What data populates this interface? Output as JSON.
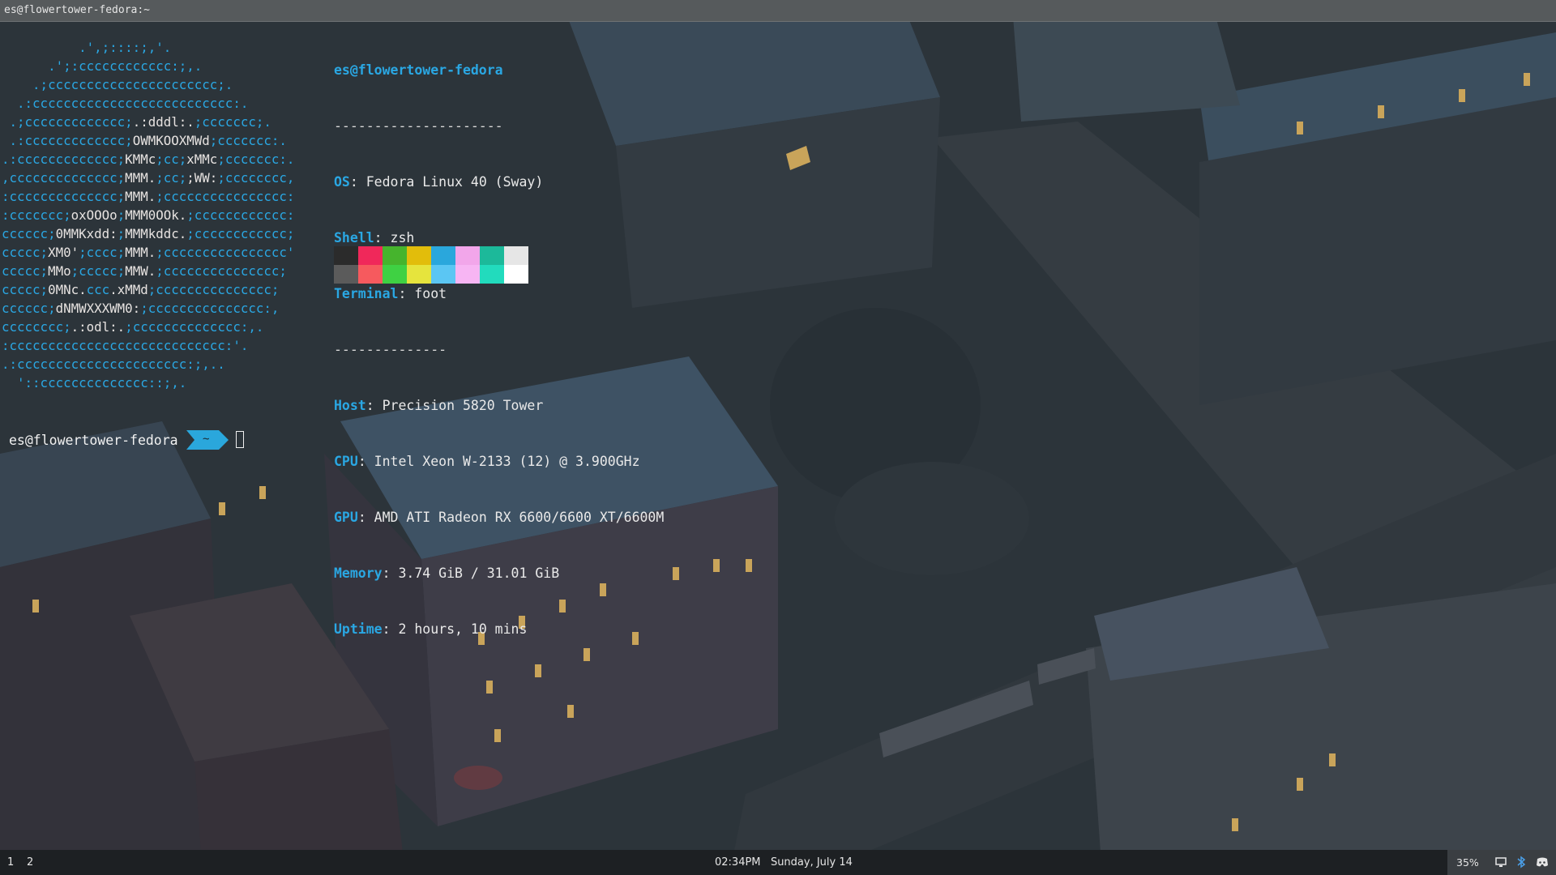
{
  "window": {
    "title": "es@flowertower-fedora:~"
  },
  "logo_lines": [
    [
      [
        "b",
        "          .',;::::;,'."
      ]
    ],
    [
      [
        "b",
        "      .';:cccccccccccc:;,."
      ]
    ],
    [
      [
        "b",
        "    .;cccccccccccccccccccccc;."
      ]
    ],
    [
      [
        "b",
        "  .:cccccccccccccccccccccccccc:."
      ]
    ],
    [
      [
        "b",
        " .;ccccccccccccc;"
      ],
      [
        "w",
        ".:dddl:."
      ],
      [
        "b",
        ";ccccccc;."
      ]
    ],
    [
      [
        "b",
        " .:ccccccccccccc;"
      ],
      [
        "w",
        "OWMKOOXMWd"
      ],
      [
        "b",
        ";ccccccc:."
      ]
    ],
    [
      [
        "b",
        ".:ccccccccccccc;"
      ],
      [
        "w",
        "KMMc"
      ],
      [
        "b",
        ";cc;"
      ],
      [
        "w",
        "xMMc"
      ],
      [
        "b",
        ";ccccccc:."
      ]
    ],
    [
      [
        "b",
        ",cccccccccccccc;"
      ],
      [
        "w",
        "MMM."
      ],
      [
        "b",
        ";cc;"
      ],
      [
        "w",
        ";WW:"
      ],
      [
        "b",
        ";cccccccc,"
      ]
    ],
    [
      [
        "b",
        ":cccccccccccccc;"
      ],
      [
        "w",
        "MMM."
      ],
      [
        "b",
        ";cccccccccccccccc:"
      ]
    ],
    [
      [
        "b",
        ":ccccccc;"
      ],
      [
        "w",
        "oxOOOo"
      ],
      [
        "b",
        ";"
      ],
      [
        "w",
        "MMM0OOk."
      ],
      [
        "b",
        ";cccccccccccc:"
      ]
    ],
    [
      [
        "b",
        "cccccc;"
      ],
      [
        "w",
        "0MMKxdd:"
      ],
      [
        "b",
        ";"
      ],
      [
        "w",
        "MMMkddc."
      ],
      [
        "b",
        ";cccccccccccc;"
      ]
    ],
    [
      [
        "b",
        "ccccc;"
      ],
      [
        "w",
        "XM0'"
      ],
      [
        "b",
        ";cccc;"
      ],
      [
        "w",
        "MMM."
      ],
      [
        "b",
        ";cccccccccccccccc'"
      ]
    ],
    [
      [
        "b",
        "ccccc;"
      ],
      [
        "w",
        "MMo"
      ],
      [
        "b",
        ";ccccc;"
      ],
      [
        "w",
        "MMW."
      ],
      [
        "b",
        ";ccccccccccccccc;"
      ]
    ],
    [
      [
        "b",
        "ccccc;"
      ],
      [
        "w",
        "0MNc."
      ],
      [
        "b",
        "ccc"
      ],
      [
        "w",
        ".xMMd"
      ],
      [
        "b",
        ";ccccccccccccccc;"
      ]
    ],
    [
      [
        "b",
        "cccccc;"
      ],
      [
        "w",
        "dNMWXXXWM0:"
      ],
      [
        "b",
        ";ccccccccccccccc:,"
      ]
    ],
    [
      [
        "b",
        "cccccccc;"
      ],
      [
        "w",
        ".:odl:."
      ],
      [
        "b",
        ";cccccccccccccc:,."
      ]
    ],
    [
      [
        "b",
        ":cccccccccccccccccccccccccccc:'."
      ]
    ],
    [
      [
        "b",
        ".:cccccccccccccccccccccc:;,.."
      ]
    ],
    [
      [
        "b",
        "  '::cccccccccccccc::;,."
      ]
    ]
  ],
  "sysinfo": {
    "user_host": "es@flowertower-fedora",
    "separator": "---------------------",
    "os_label": "OS",
    "os_value": ": Fedora Linux 40 (Sway)",
    "shell_label": "Shell",
    "shell_value": ": zsh",
    "terminal_label": "Terminal",
    "terminal_value": ": foot",
    "separator2": "--------------",
    "host_label": "Host",
    "host_value": ": Precision 5820 Tower",
    "cpu_label": "CPU",
    "cpu_value": ": Intel Xeon W-2133 (12) @ 3.900GHz",
    "gpu_label": "GPU",
    "gpu_value": ": AMD ATI Radeon RX 6600/6600 XT/6600M",
    "memory_label": "Memory",
    "memory_value": ": 3.74 GiB / 31.01 GiB",
    "uptime_label": "Uptime",
    "uptime_value": ": 2 hours, 10 mins"
  },
  "palette": [
    "#2b2b2b",
    "#f0285a",
    "#46b42d",
    "#e2bd0b",
    "#2aa7dc",
    "#f2a6ea",
    "#1cb99a",
    "#e6e6e6",
    "#5b5b5b",
    "#f65a5e",
    "#3fd143",
    "#e6e43d",
    "#5bc6f3",
    "#f7b5f3",
    "#22dbbd",
    "#ffffff"
  ],
  "prompt": {
    "host": "es@flowertower-fedora",
    "dir": "~",
    "segment_color": "#2aa7dc"
  },
  "bar": {
    "workspaces": [
      "1",
      "2"
    ],
    "time": "02:34PM",
    "date": "Sunday, July 14",
    "brightness": "35%"
  },
  "icons": [
    "display-icon",
    "bluetooth-icon",
    "discord-icon"
  ]
}
